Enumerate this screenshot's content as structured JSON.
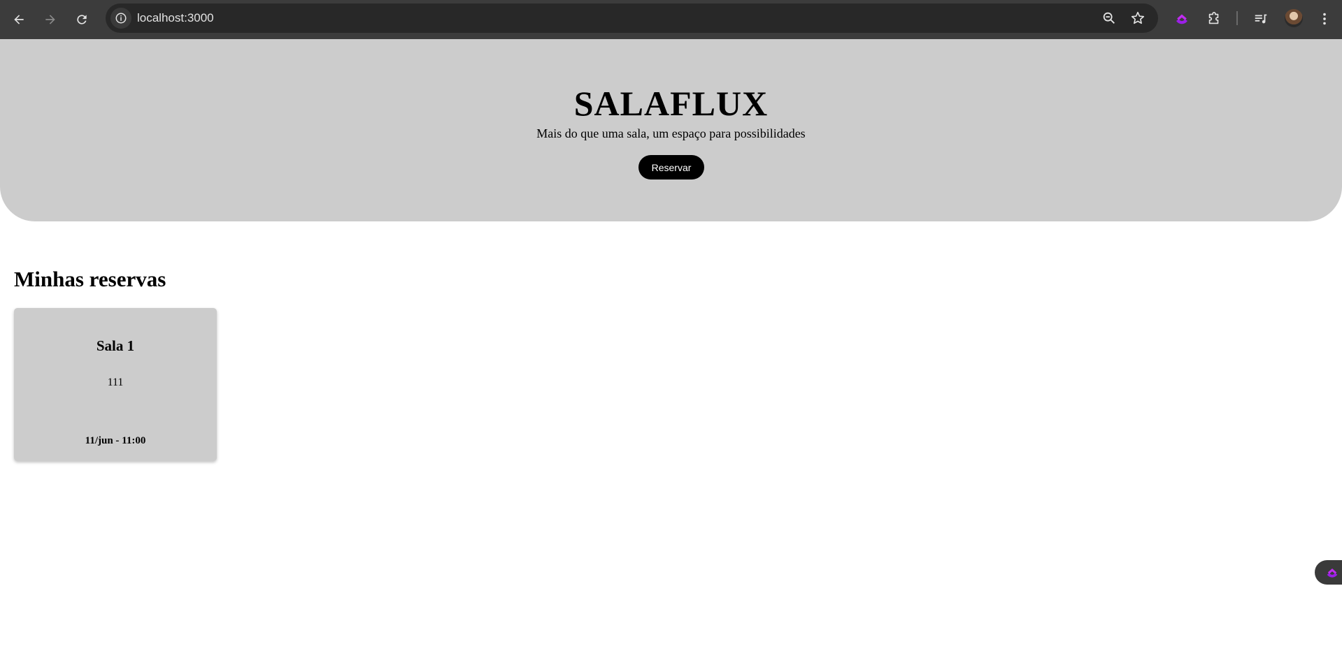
{
  "browser": {
    "url": "localhost:3000",
    "icons": {
      "back": "arrow-left-icon",
      "forward": "arrow-right-icon",
      "reload": "reload-icon",
      "site_info": "info-icon",
      "zoom": "zoom-out-icon",
      "bookmark": "star-icon",
      "extension": "clickup-icon",
      "extensions_menu": "puzzle-icon",
      "reading_list": "queue-music-icon",
      "profile": "avatar",
      "menu": "kebab-menu-icon"
    }
  },
  "hero": {
    "title": "SALAFLUX",
    "subtitle": "Mais do que uma sala, um espaço para possibilidades",
    "button_label": "Reservar"
  },
  "reservations": {
    "title": "Minhas reservas",
    "items": [
      {
        "room": "Sala 1",
        "code": "111",
        "datetime": "11/jun - 11:00"
      }
    ]
  },
  "colors": {
    "hero_bg": "#cccccc",
    "card_bg": "#cccccc",
    "button_bg": "#000000",
    "extension_accent": "#9b1fe8"
  }
}
